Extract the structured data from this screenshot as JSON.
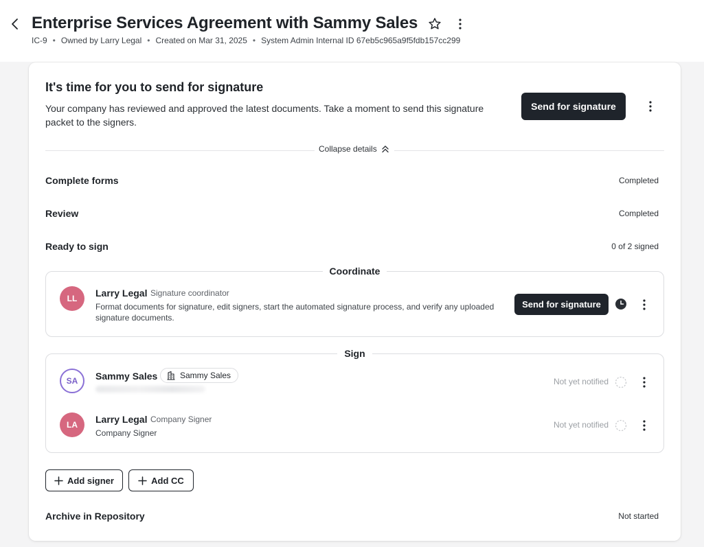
{
  "header": {
    "title": "Enterprise Services Agreement with Sammy Sales",
    "meta": {
      "id": "IC-9",
      "owner": "Owned by Larry Legal",
      "created": "Created on Mar 31, 2025",
      "internal_id": "System Admin Internal ID 67eb5c965a9f5fdb157cc299"
    }
  },
  "hero": {
    "title": "It's time for you to send for signature",
    "description": "Your company has reviewed and approved the latest documents. Take a moment to send this signature packet to the signers.",
    "send_button": "Send for signature"
  },
  "details": {
    "collapse_label": "Collapse details",
    "steps": [
      {
        "label": "Complete forms",
        "status": "Completed"
      },
      {
        "label": "Review",
        "status": "Completed"
      },
      {
        "label": "Ready to sign",
        "status": "0 of 2 signed"
      }
    ],
    "archive": {
      "label": "Archive in Repository",
      "status": "Not started"
    }
  },
  "coordinate": {
    "title": "Coordinate",
    "person": {
      "initials": "LL",
      "name": "Larry Legal",
      "role": "Signature coordinator",
      "description": "Format documents for signature, edit signers, start the automated signature process, and verify any uploaded signature documents.",
      "button": "Send for signature"
    }
  },
  "sign": {
    "title": "Sign",
    "signers": [
      {
        "initials": "SA",
        "name": "Sammy Sales",
        "org_chip": "Sammy Sales",
        "status": "Not yet notified"
      },
      {
        "initials": "LA",
        "name": "Larry Legal",
        "role": "Company Signer",
        "subtitle": "Company Signer",
        "status": "Not yet notified"
      }
    ]
  },
  "actions": {
    "add_signer": "Add signer",
    "add_cc": "Add CC"
  },
  "colors": {
    "primary_button": "#1f242b",
    "avatar_pink": "#d6677f",
    "avatar_outline": "#8a70d6",
    "muted_text": "#9b9fa4"
  }
}
